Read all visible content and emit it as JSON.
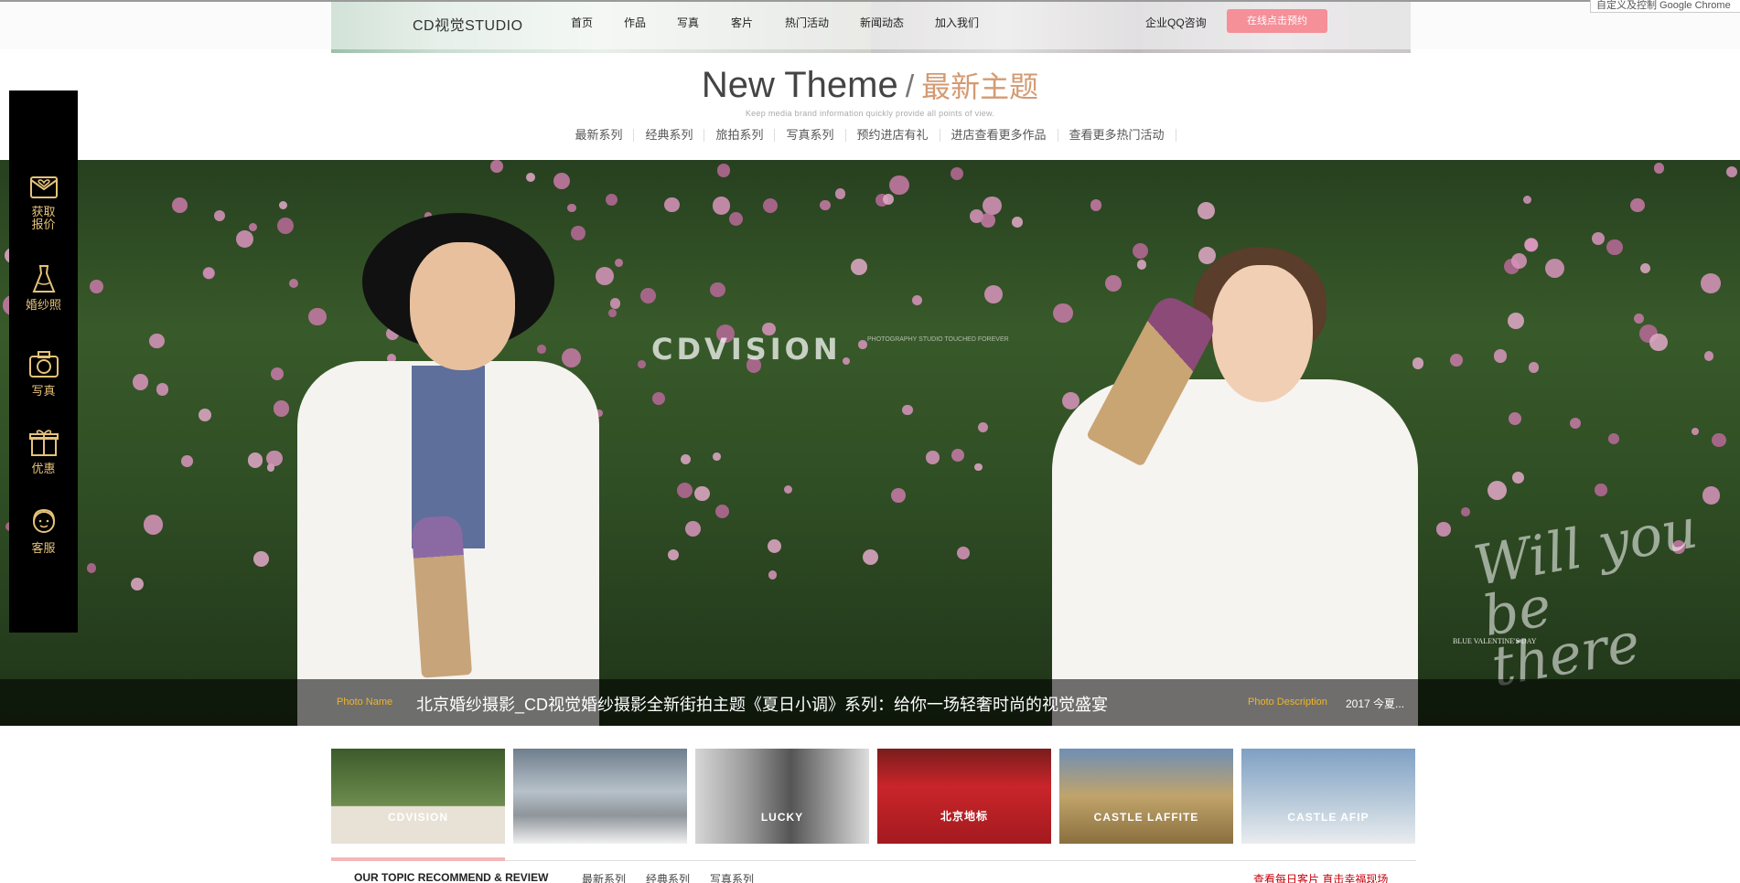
{
  "header": {
    "brand": "CD视觉STUDIO",
    "nav": [
      "首页",
      "作品",
      "写真",
      "客片",
      "热门活动",
      "新闻动态",
      "加入我们"
    ],
    "qq_label": "企业QQ咨询",
    "book_button": "在线点击预约",
    "chrome_popup": "自定义及控制 Google Chrome"
  },
  "theme": {
    "title_en": "New Theme",
    "slash": "/",
    "title_cn": "最新主题",
    "subtitle": "Keep media brand information quickly provide all points of view.",
    "categories": [
      "最新系列",
      "经典系列",
      "旅拍系列",
      "写真系列",
      "预约进店有礼",
      "进店查看更多作品",
      "查看更多热门活动"
    ]
  },
  "hero": {
    "watermark": "CDVISION",
    "watermark_small": "PHOTOGRAPHY STUDIO TOUCHED FOREVER",
    "script_text": "Will you be there",
    "script_small": "BLUE VALENTINE'S DAY",
    "photo_name_label": "Photo Name",
    "photo_title": "北京婚纱摄影_CD视觉婚纱摄影全新街拍主题《夏日小调》系列：给你一场轻奢时尚的视觉盛宴",
    "photo_desc_label": "Photo Description",
    "photo_desc": "2017 今夏..."
  },
  "sidebar": {
    "items": [
      {
        "label": "获取报价",
        "icon": "heart-mail-icon"
      },
      {
        "label": "婚纱照",
        "icon": "wedding-dress-icon"
      },
      {
        "label": "写真",
        "icon": "camera-icon"
      },
      {
        "label": "优惠",
        "icon": "gift-icon"
      },
      {
        "label": "客服",
        "icon": "customer-service-icon"
      }
    ]
  },
  "thumbnails": [
    {
      "label": "CDVISION"
    },
    {
      "label": ""
    },
    {
      "label": "LUCKY"
    },
    {
      "label": "北京地标"
    },
    {
      "label": "CASTLE LAFFITE"
    },
    {
      "label": "CASTLE AFIP"
    }
  ],
  "recommend": {
    "title": "OUR TOPIC RECOMMEND & REVIEW",
    "tabs": [
      "最新系列",
      "经典系列",
      "写真系列"
    ],
    "right_link": "查看每日客片 直击幸福现场"
  },
  "colors": {
    "accent_gold": "#e5c27a",
    "accent_pink": "#f58f98",
    "caption_yellow": "#f0b429",
    "theme_cn": "#d49a72"
  }
}
